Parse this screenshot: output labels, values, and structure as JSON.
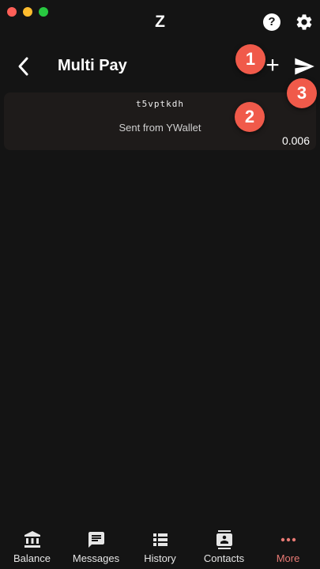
{
  "window": {
    "title": "Z"
  },
  "header": {
    "title": "Multi Pay"
  },
  "badges": [
    "1",
    "2",
    "3"
  ],
  "payments": [
    {
      "address": "t5vptkdh",
      "memo": "Sent from YWallet",
      "amount": "0.006"
    }
  ],
  "nav": {
    "items": [
      {
        "label": "Balance",
        "icon": "bank-icon"
      },
      {
        "label": "Messages",
        "icon": "message-icon"
      },
      {
        "label": "History",
        "icon": "list-icon"
      },
      {
        "label": "Contacts",
        "icon": "contacts-icon"
      },
      {
        "label": "More",
        "icon": "more-icon",
        "active": true
      }
    ]
  },
  "colors": {
    "accent": "#e87a74",
    "badge": "#f05a4a",
    "background": "#141414",
    "card": "#1e1b1a"
  },
  "icons": {
    "help": "?"
  }
}
